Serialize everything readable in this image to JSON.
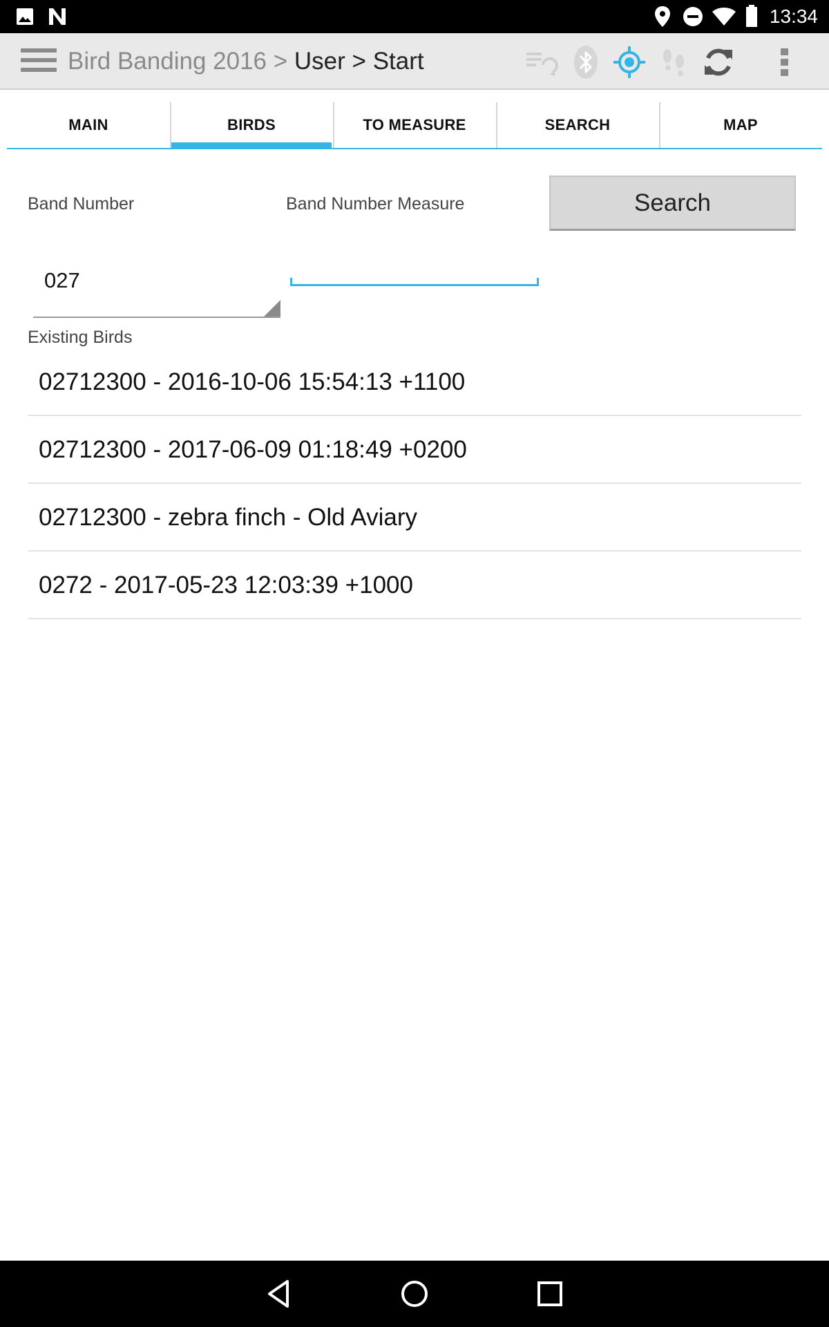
{
  "status_bar": {
    "time": "13:34",
    "icons": [
      "image-icon",
      "n-icon",
      "location-pin-icon",
      "do-not-disturb-icon",
      "wifi-icon",
      "battery-icon"
    ]
  },
  "action_bar": {
    "project": "Bird Banding 2016 >",
    "path": "User > Start",
    "icons": [
      "menu-icon",
      "sync-queue-icon",
      "bluetooth-icon",
      "gps-icon",
      "footsteps-icon",
      "refresh-icon",
      "overflow-menu-icon"
    ],
    "accent": "#33b5e5"
  },
  "tabs": [
    {
      "label": "MAIN",
      "active": false
    },
    {
      "label": "BIRDS",
      "active": true
    },
    {
      "label": "TO MEASURE",
      "active": false
    },
    {
      "label": "SEARCH",
      "active": false
    },
    {
      "label": "MAP",
      "active": false
    }
  ],
  "form": {
    "band_number_label": "Band Number",
    "band_number_measure_label": "Band Number Measure",
    "search_button": "Search",
    "band_number_value": "027",
    "band_number_measure_value": ""
  },
  "existing_birds": {
    "label": "Existing Birds",
    "items": [
      "02712300 - 2016-10-06 15:54:13 +1100",
      "02712300 - 2017-06-09 01:18:49 +0200",
      "02712300 - zebra finch - Old Aviary",
      "0272 - 2017-05-23 12:03:39 +1000"
    ]
  },
  "nav_bar": {
    "icons": [
      "back-icon",
      "home-icon",
      "recents-icon"
    ]
  }
}
